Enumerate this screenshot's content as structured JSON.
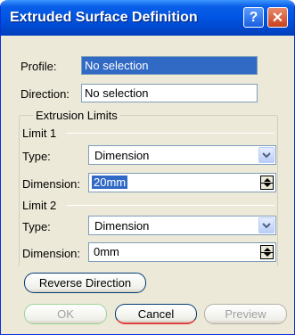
{
  "window": {
    "title": "Extruded Surface Definition",
    "help_label": "?",
    "close_label": "✕"
  },
  "profile": {
    "label": "Profile:",
    "value": "No selection"
  },
  "direction": {
    "label": "Direction:",
    "value": "No selection"
  },
  "limits": {
    "group_label": "Extrusion Limits",
    "limit1": {
      "label": "Limit 1",
      "type_label": "Type:",
      "type_value": "Dimension",
      "dimension_label": "Dimension:",
      "dimension_value": "20mm"
    },
    "limit2": {
      "label": "Limit 2",
      "type_label": "Type:",
      "type_value": "Dimension",
      "dimension_label": "Dimension:",
      "dimension_value": "0mm"
    }
  },
  "buttons": {
    "reverse": "Reverse Direction",
    "ok": "OK",
    "cancel": "Cancel",
    "preview": "Preview"
  }
}
